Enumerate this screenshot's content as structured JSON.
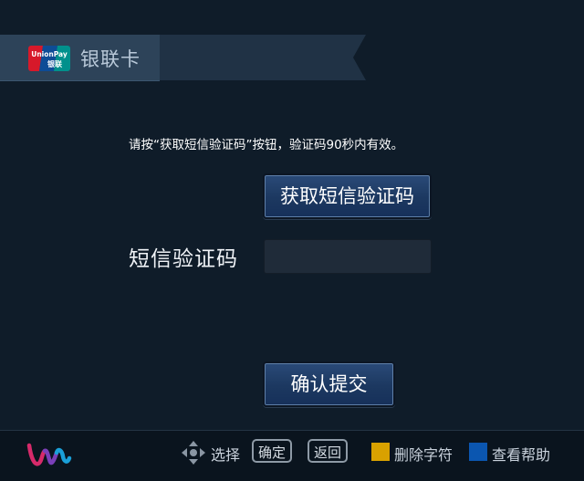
{
  "header": {
    "title": "银联卡",
    "logo_text_top": "UnionPay",
    "logo_text_bottom": "银联"
  },
  "main": {
    "instruction": "请按“获取短信验证码”按钮，验证码90秒内有效。",
    "get_code_button": "获取短信验证码",
    "code_label": "短信验证码",
    "code_input_value": "",
    "confirm_button": "确认提交"
  },
  "footer": {
    "select_label": "选择",
    "ok_key": "确定",
    "back_key": "返回",
    "delete_label": "删除字符",
    "help_label": "查看帮助",
    "delete_color": "#d9a100",
    "help_color": "#0b56b0"
  }
}
